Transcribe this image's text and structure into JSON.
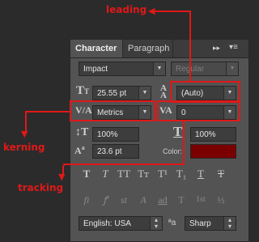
{
  "panel": {
    "tabs": [
      {
        "label": "Character"
      },
      {
        "label": "Paragraph"
      }
    ],
    "menu_glyphs": {
      "collapse": "▸▸",
      "menu": "▾≡"
    },
    "font_family": "Impact",
    "font_style": "Regular",
    "font_size": "25.55 pt",
    "leading": "(Auto)",
    "kerning": "Metrics",
    "tracking": "0",
    "vertical_scale": "100%",
    "horizontal_scale": "100%",
    "baseline_shift": "23.6 pt",
    "color_label": "Color:",
    "color_value": "#7a0000",
    "style_buttons": [
      "T",
      "T",
      "TT",
      "Tт",
      "T¹",
      "T₁",
      "T",
      "T"
    ],
    "opentype_buttons": [
      "fi",
      "ꝭ",
      "st",
      "A",
      "ad",
      "T",
      "1st",
      "½"
    ],
    "language": "English: USA",
    "aa_icon": "ªa",
    "antialias": "Sharp"
  },
  "annotations": {
    "leading": "leading",
    "kerning": "kerning",
    "tracking": "tracking"
  },
  "colors": {
    "accent": "#e01818"
  }
}
